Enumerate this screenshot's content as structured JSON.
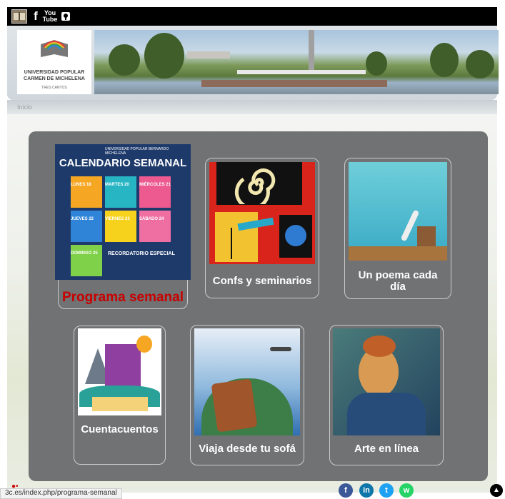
{
  "topbar": {
    "icons": [
      "books-icon",
      "facebook-icon",
      "youtube-icon",
      "pinterest-icon"
    ],
    "youtube_text": "You Tube",
    "facebook_glyph": "f"
  },
  "header": {
    "logo_line1": "UNIVERSIDAD POPULAR",
    "logo_line2": "CARMEN DE MICHELENA",
    "logo_line3": "TRES CANTOS"
  },
  "breadcrumb": {
    "home": "Inicio"
  },
  "cards": [
    {
      "id": "programa",
      "label": "Programa semanal",
      "poster": {
        "brand": "UNIVERSIDAD POPULAR BERNARDO MICHELENA",
        "title": "CALENDARIO SEMANAL",
        "days": [
          "LUNES 18",
          "MARTES 20",
          "MIÉRCOLES 21",
          "JUEVES 22",
          "VIERNES 23",
          "SÁBADO 24",
          "DOMINGO 25"
        ],
        "note_title": "RECORDATORIO ESPECIAL"
      }
    },
    {
      "id": "confs",
      "label": "Confs y seminarios"
    },
    {
      "id": "poema",
      "label": "Un poema cada día"
    },
    {
      "id": "cuentos",
      "label": "Cuentacuentos"
    },
    {
      "id": "viaja",
      "label": "Viaja desde tu sofá"
    },
    {
      "id": "arte",
      "label": "Arte en línea"
    }
  ],
  "status": {
    "url": "3c.es/index.php/programa-semanal"
  },
  "share": {
    "facebook": "f",
    "linkedin": "in",
    "twitter": "t",
    "whatsapp": "w"
  },
  "colors": {
    "panel": "#707274",
    "featured_label": "#c80000",
    "facebook": "#3b5998",
    "linkedin": "#0e76a8",
    "twitter": "#1da1f2",
    "whatsapp": "#25d366"
  }
}
